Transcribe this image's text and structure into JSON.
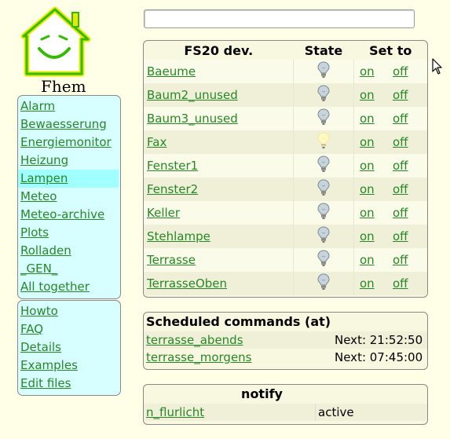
{
  "logo": {
    "text": "Fhem"
  },
  "search": {
    "value": ""
  },
  "menu_main": [
    {
      "label": "Alarm",
      "selected": false
    },
    {
      "label": "Bewaesserung",
      "selected": false
    },
    {
      "label": "Energiemonitor",
      "selected": false
    },
    {
      "label": "Heizung",
      "selected": false
    },
    {
      "label": "Lampen",
      "selected": true
    },
    {
      "label": "Meteo",
      "selected": false
    },
    {
      "label": "Meteo-archive",
      "selected": false
    },
    {
      "label": "Plots",
      "selected": false
    },
    {
      "label": "Rolladen",
      "selected": false
    },
    {
      "label": "_GEN_",
      "selected": false
    },
    {
      "label": "All together",
      "selected": false
    }
  ],
  "menu_help": [
    {
      "label": "Howto"
    },
    {
      "label": "FAQ"
    },
    {
      "label": "Details"
    },
    {
      "label": "Examples"
    },
    {
      "label": "Edit files"
    }
  ],
  "fs20": {
    "headers": {
      "device": "FS20 dev.",
      "state": "State",
      "setto": "Set to"
    },
    "devices": [
      {
        "name": "Baeume",
        "state_icon": "bulb-off-icon",
        "on": "on",
        "off": "off"
      },
      {
        "name": "Baum2_unused",
        "state_icon": "bulb-off-icon",
        "on": "on",
        "off": "off"
      },
      {
        "name": "Baum3_unused",
        "state_icon": "bulb-off-icon",
        "on": "on",
        "off": "off"
      },
      {
        "name": "Fax",
        "state_icon": "bulb-on-icon",
        "on": "on",
        "off": "off"
      },
      {
        "name": "Fenster1",
        "state_icon": "bulb-off-icon",
        "on": "on",
        "off": "off"
      },
      {
        "name": "Fenster2",
        "state_icon": "bulb-off-icon",
        "on": "on",
        "off": "off"
      },
      {
        "name": "Keller",
        "state_icon": "bulb-off-icon",
        "on": "on",
        "off": "off"
      },
      {
        "name": "Stehlampe",
        "state_icon": "bulb-off-icon",
        "on": "on",
        "off": "off"
      },
      {
        "name": "Terrasse",
        "state_icon": "bulb-off-icon",
        "on": "on",
        "off": "off"
      },
      {
        "name": "TerrasseOben",
        "state_icon": "bulb-off-icon",
        "on": "on",
        "off": "off"
      }
    ]
  },
  "at": {
    "title": "Scheduled commands (at)",
    "rows": [
      {
        "name": "terrasse_abends",
        "value": "Next: 21:52:50"
      },
      {
        "name": "terrasse_morgens",
        "value": "Next: 07:45:00"
      }
    ]
  },
  "notify": {
    "title": "notify",
    "rows": [
      {
        "name": "n_flurlicht",
        "value": "active"
      }
    ]
  },
  "colors": {
    "background": "#ffffe7",
    "link": "#278727",
    "menu_bg": "#d7ffff",
    "menu_selected": "#a0ffff",
    "logo_green": "#33bb00",
    "logo_yellow": "#e8e800"
  }
}
